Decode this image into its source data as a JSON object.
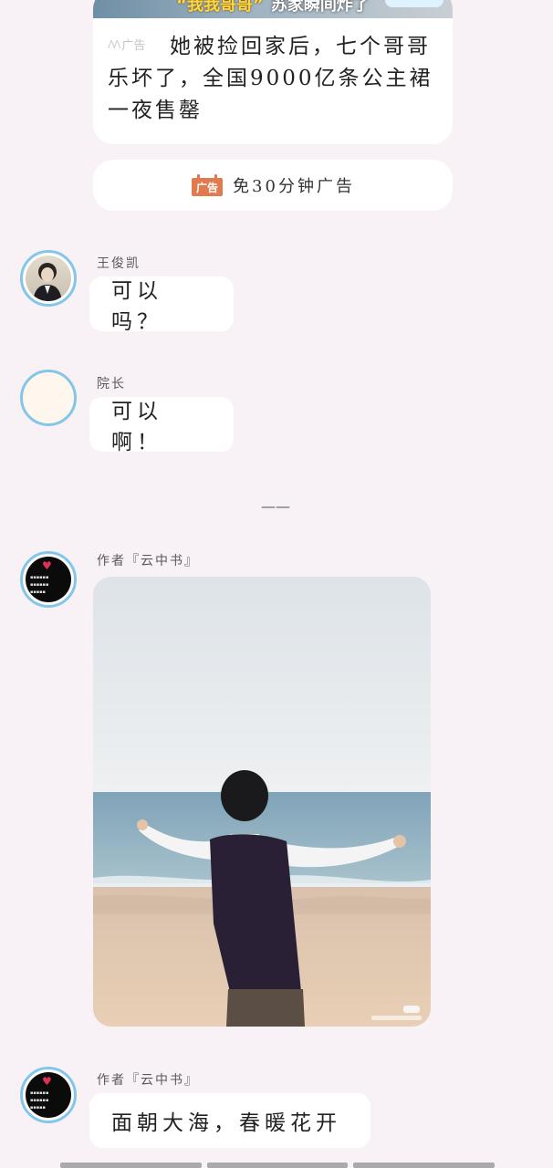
{
  "ad_card": {
    "banner_quote_text": "“我我哥哥”",
    "banner_text": "苏家瞬间炸了",
    "badge_label": "广告",
    "text": "她被捡回家后，七个哥哥乐坏了，全国9000亿条公主裙一夜售罄"
  },
  "skip_ad": {
    "icon_text": "广告",
    "label": "免30分钟广告"
  },
  "messages": [
    {
      "sender": "王俊凯",
      "text": "可以吗？"
    },
    {
      "sender": "院长",
      "text": "可以啊！"
    },
    {
      "sender": "作者『云中书』",
      "image": "beach-photo"
    },
    {
      "sender": "作者『云中书』",
      "text": "面朝大海，春暖花开"
    }
  ],
  "divider": "——",
  "colors": {
    "background": "#f8f2f6",
    "bubble": "#ffffff",
    "avatar_ring": "#84c6e8",
    "ad_icon": "#e07a4f"
  }
}
